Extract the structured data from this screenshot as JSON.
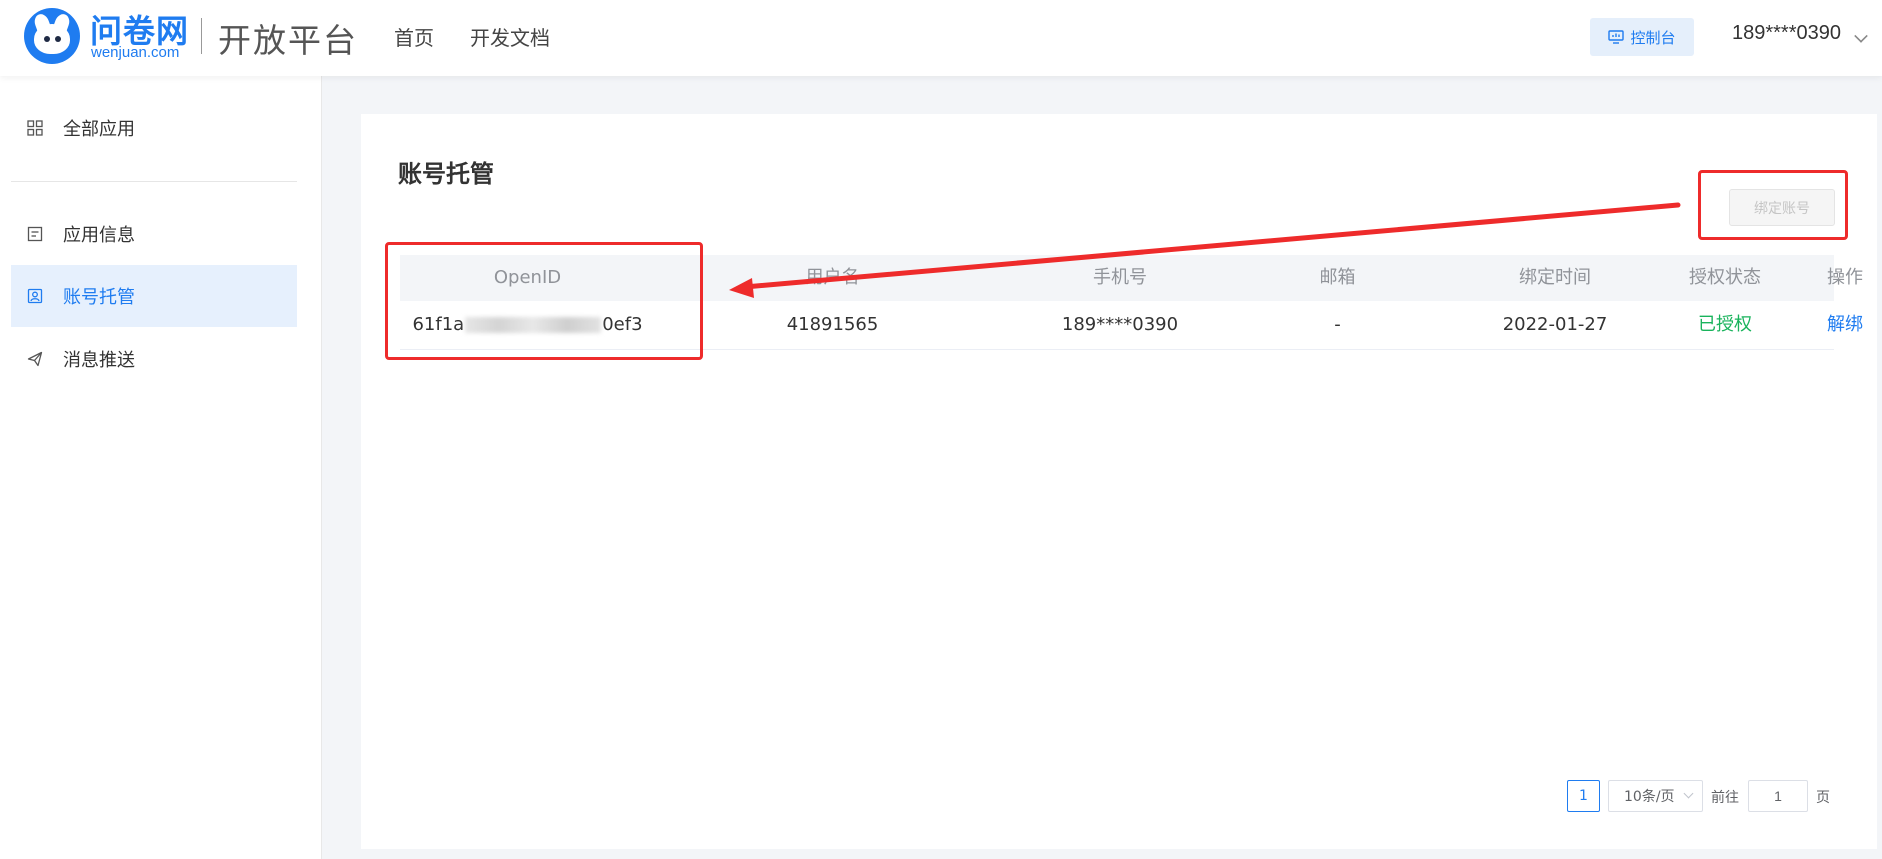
{
  "header": {
    "logo_cn": "问卷网",
    "logo_en": "wenjuan.com",
    "platform": "开放平台",
    "nav": [
      "首页",
      "开发文档"
    ],
    "console_label": "控制台",
    "user": "189****0390"
  },
  "sidebar": {
    "items": [
      {
        "label": "全部应用",
        "icon": "grid-icon"
      },
      {
        "label": "应用信息",
        "icon": "document-icon"
      },
      {
        "label": "账号托管",
        "icon": "user-badge-icon",
        "active": true
      },
      {
        "label": "消息推送",
        "icon": "send-icon"
      }
    ]
  },
  "page": {
    "title": "账号托管",
    "bind_button": "绑定账号"
  },
  "table": {
    "headers": [
      "OpenID",
      "用户名",
      "手机号",
      "邮箱",
      "绑定时间",
      "授权状态",
      "操作"
    ],
    "rows": [
      {
        "openid_prefix": "61f1a",
        "openid_suffix": "0ef3",
        "username": "41891565",
        "phone": "189****0390",
        "email": "-",
        "bind_time": "2022-01-27",
        "auth_status": "已授权",
        "action": "解绑"
      }
    ]
  },
  "pagination": {
    "current_page": "1",
    "page_size": "10条/页",
    "goto_label": "前往",
    "goto_value": "1",
    "page_suffix": "页"
  },
  "colors": {
    "primary": "#1f7cf0",
    "success": "#19b35c",
    "annotation": "#ee2b2b"
  }
}
